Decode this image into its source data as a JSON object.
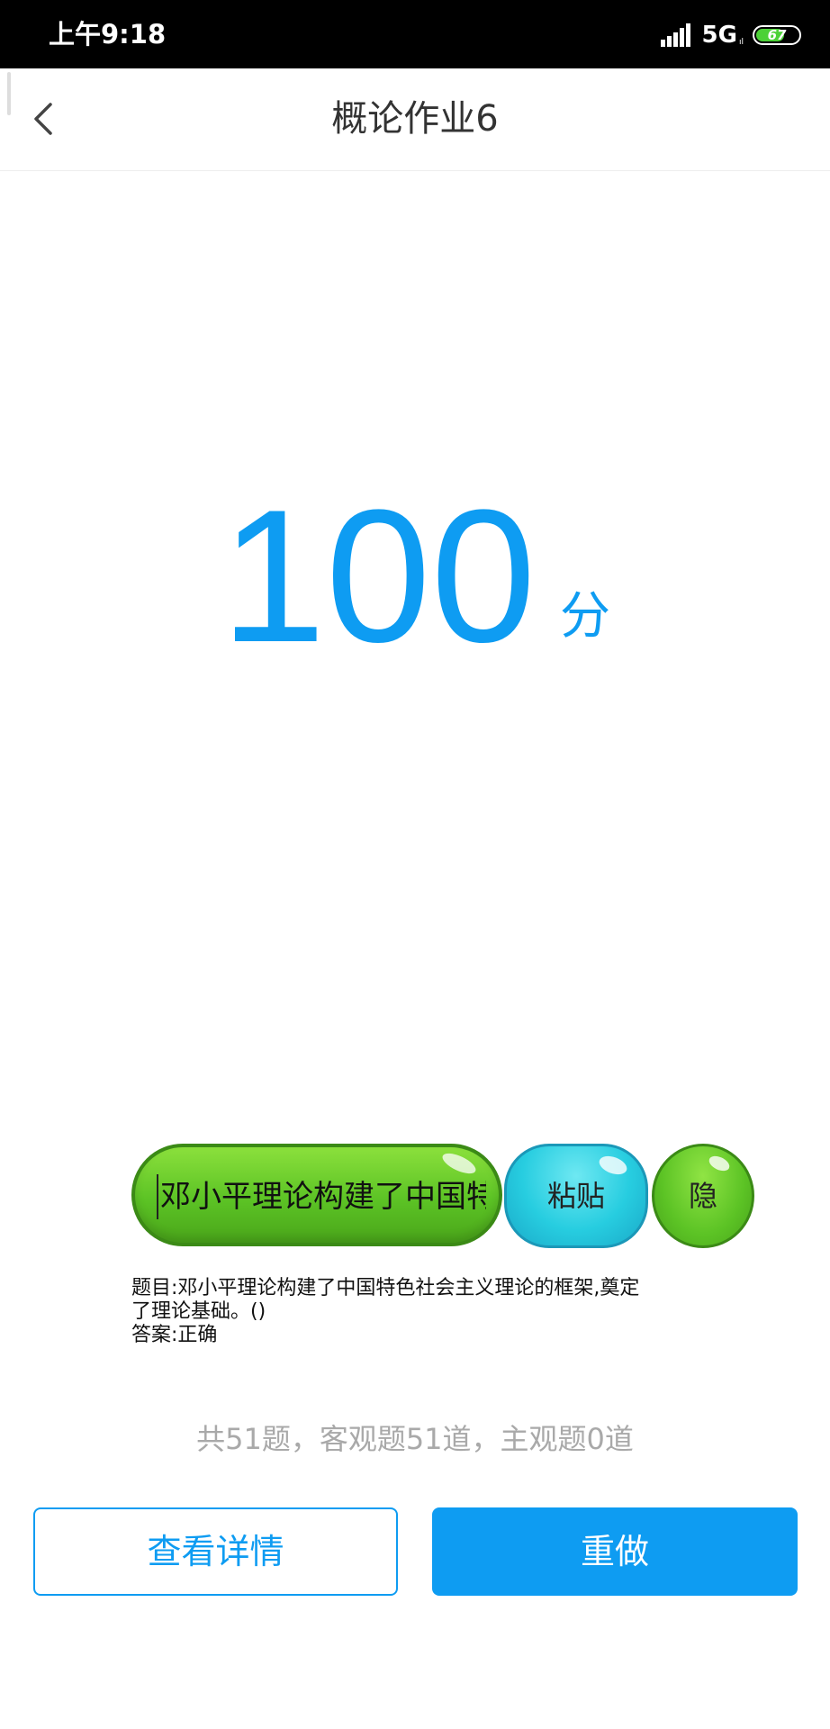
{
  "status_bar": {
    "time": "上午9:18",
    "network": "5G",
    "network_sub": "ıl",
    "battery_level": "67",
    "battery_fraction": 0.67,
    "battery_color": "#4cd137"
  },
  "header": {
    "back_icon": "chevron-left-icon",
    "title": "概论作业6"
  },
  "score": {
    "value": "100",
    "unit": "分",
    "color": "#0e9cf2"
  },
  "helper_overlay": {
    "input_value": "邓小平理论构建了中国特",
    "paste_label": "粘贴",
    "hide_label": "隐",
    "question": "题目:邓小平理论构建了中国特色社会主义理论的框架,奠定了理论基础。()",
    "answer": "答案:正确"
  },
  "summary": "共51题，客观题51道，主观题0道",
  "actions": {
    "detail_label": "查看详情",
    "redo_label": "重做",
    "primary_color": "#0e9cf2"
  }
}
